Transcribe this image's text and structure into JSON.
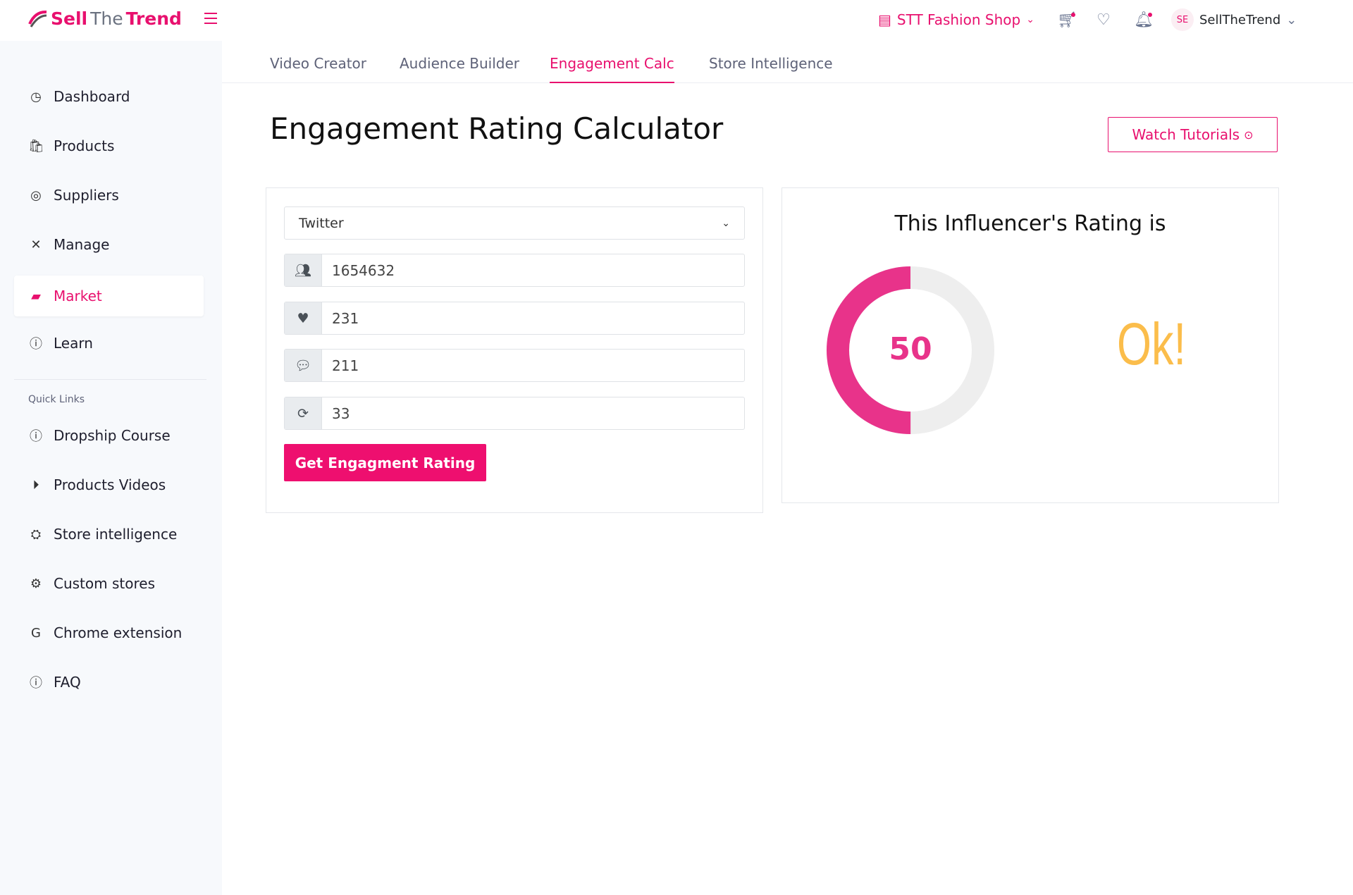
{
  "brand": {
    "logo_parts": [
      "Sell",
      "The",
      "Trend"
    ]
  },
  "topbar": {
    "shop": "STT Fashion Shop",
    "user_initials": "SE",
    "user_name": "SellTheTrend"
  },
  "sidebar": {
    "items": [
      {
        "label": "Dashboard",
        "icon": "gauge-icon"
      },
      {
        "label": "Products",
        "icon": "bag-icon"
      },
      {
        "label": "Suppliers",
        "icon": "globe-icon"
      },
      {
        "label": "Manage",
        "icon": "tools-icon"
      },
      {
        "label": "Market",
        "icon": "chat-icon",
        "active": true
      },
      {
        "label": "Learn",
        "icon": "help-icon"
      }
    ],
    "quick_links_title": "Quick Links",
    "quick_links": [
      {
        "label": "Dropship Course",
        "icon": "help-icon"
      },
      {
        "label": "Products Videos",
        "icon": "play-icon"
      },
      {
        "label": "Store intelligence",
        "icon": "spy-icon"
      },
      {
        "label": "Custom stores",
        "icon": "gear-icon"
      },
      {
        "label": "Chrome extension",
        "icon": "google-icon"
      },
      {
        "label": "FAQ",
        "icon": "help-icon"
      }
    ]
  },
  "tabs": [
    {
      "label": "Video Creator"
    },
    {
      "label": "Audience Builder"
    },
    {
      "label": "Engagement Calc",
      "active": true
    },
    {
      "label": "Store Intelligence"
    }
  ],
  "page": {
    "title": "Engagement Rating Calculator",
    "watch_label": "Watch Tutorials"
  },
  "form": {
    "platform": "Twitter",
    "followers": "1654632",
    "likes": "231",
    "comments": "211",
    "shares": "33",
    "submit": "Get Engagment Rating"
  },
  "result": {
    "title": "This Influencer's Rating is",
    "score": "50",
    "score_value": 50,
    "score_max": 100,
    "verdict": "Ok!"
  },
  "colors": {
    "accent": "#e8106e",
    "ring": "#e8338a",
    "ring_track": "#eeeeee",
    "verdict": "#fbbd4b"
  }
}
